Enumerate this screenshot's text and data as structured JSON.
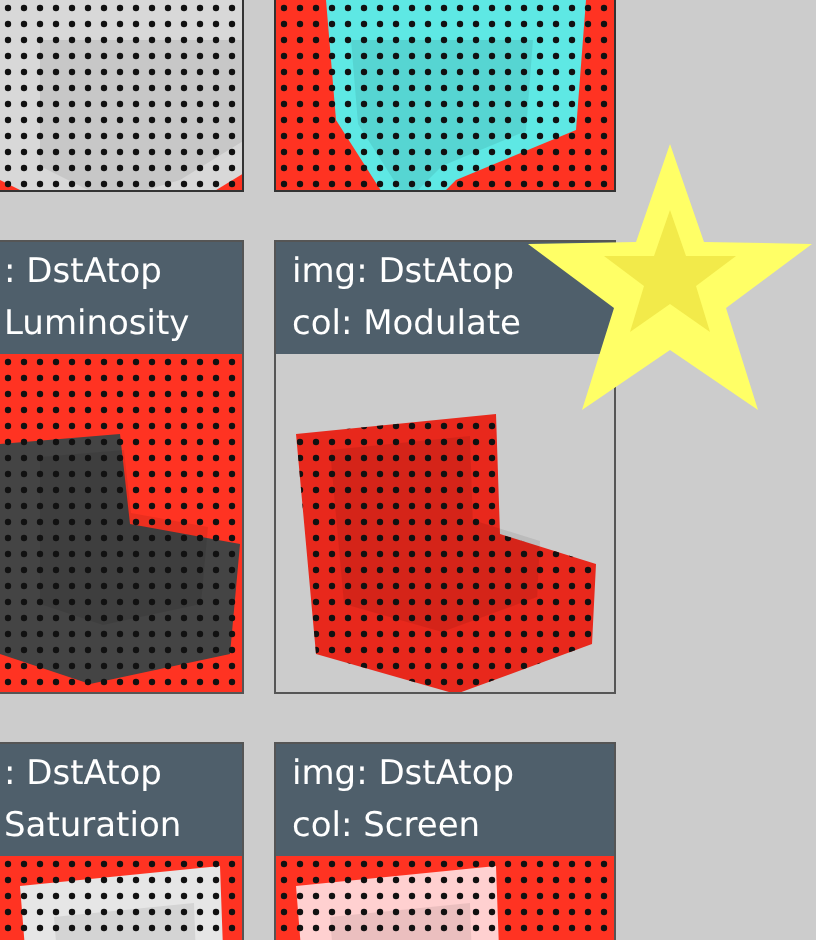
{
  "tiles": [
    {
      "image_mode": ": DstAtop",
      "color_mode": "Luminosity"
    },
    {
      "image_mode": "img: DstAtop",
      "color_mode": "col: Modulate"
    },
    {
      "image_mode": ": DstAtop",
      "color_mode": "Saturation"
    },
    {
      "image_mode": "img: DstAtop",
      "color_mode": "col: Screen"
    }
  ]
}
